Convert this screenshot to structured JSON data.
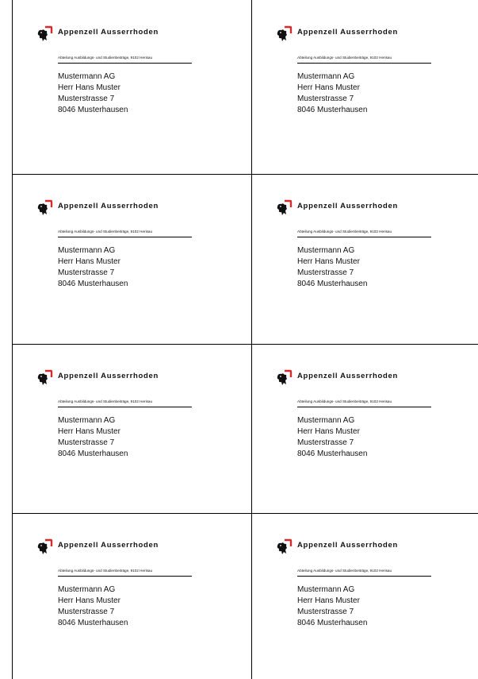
{
  "org_name": "Appenzell Ausserrhoden",
  "sender_line": "Abteilung Ausbildungs- und Studienbeiträge, 9102 Herisau",
  "address": {
    "company": "Mustermann AG",
    "person": "Herr Hans Muster",
    "street": "Musterstrasse 7",
    "city": "8046 Musterhausen"
  },
  "colors": {
    "accent": "#d42b2b",
    "text": "#111111",
    "lines": "#000000"
  },
  "icons": {
    "logo": "appenzell-bear-coat-of-arms"
  },
  "grid": {
    "columns": 2,
    "rows": 4
  }
}
